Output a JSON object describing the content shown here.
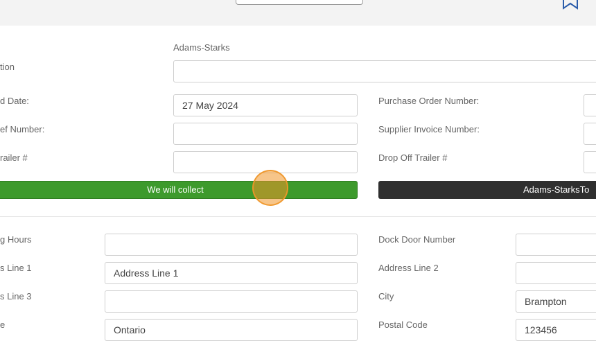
{
  "header": {
    "icon": "star-outline-icon"
  },
  "form": {
    "supplier_name": "Adams-Starks",
    "labels": {
      "location": "tion",
      "collected_date": "d Date:",
      "ref_number": "ef Number:",
      "trailer": "railer #",
      "purchase_order_number": "Purchase Order Number:",
      "supplier_invoice_number": "Supplier Invoice Number:",
      "drop_off_trailer": "Drop Off Trailer #"
    },
    "values": {
      "location": "",
      "collected_date": "27 May 2024",
      "ref_number": "",
      "trailer": "",
      "purchase_order_number": "",
      "supplier_invoice_number": "",
      "drop_off_trailer": ""
    },
    "buttons": {
      "we_will_collect": "We will collect",
      "supplier_to": "Adams-StarksTo"
    }
  },
  "address": {
    "labels": {
      "opening_hours": "g Hours",
      "dock_door_number": "Dock Door Number",
      "address_line_1": "s Line 1",
      "address_line_2": "Address Line 2",
      "address_line_3": "s Line 3",
      "city": "City",
      "province": "e",
      "postal_code": "Postal Code"
    },
    "values": {
      "opening_hours": "",
      "dock_door_number": "",
      "address_line_1": "Address Line 1",
      "address_line_2": "",
      "address_line_3": "",
      "city": "Brampton",
      "province": "Ontario",
      "postal_code": "123456"
    }
  },
  "colors": {
    "green_button": "#3d9a2c",
    "dark_button": "#2f2f2f",
    "cursor": "#f0962a"
  }
}
